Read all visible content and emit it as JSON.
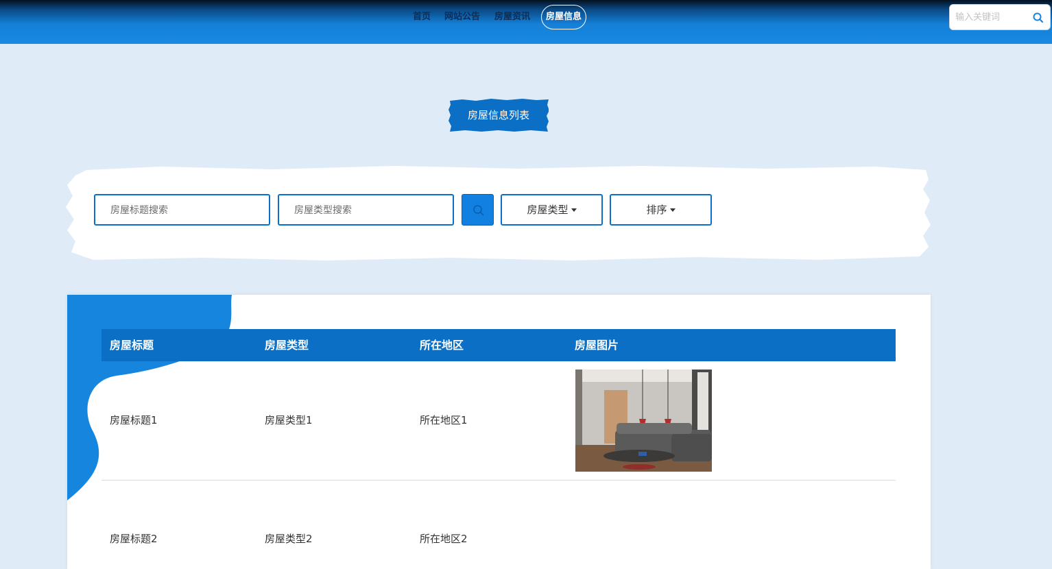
{
  "nav": {
    "items": [
      "首页",
      "网站公告",
      "房屋资讯",
      "房屋信息"
    ],
    "active_index": 3
  },
  "search": {
    "placeholder": "输入关键词"
  },
  "page_title": "房屋信息列表",
  "filters": {
    "title_placeholder": "房屋标题搜索",
    "type_placeholder": "房屋类型搜索",
    "type_dropdown": "房屋类型",
    "sort_dropdown": "排序"
  },
  "table": {
    "headers": [
      "房屋标题",
      "房屋类型",
      "所在地区",
      "房屋图片"
    ],
    "rows": [
      {
        "title": "房屋标题1",
        "type": "房屋类型1",
        "region": "所在地区1"
      },
      {
        "title": "房屋标题2",
        "type": "房屋类型2",
        "region": "所在地区2"
      }
    ]
  },
  "colors": {
    "accent": "#0b6fc6",
    "background": "#dfecf8",
    "nav_bright": "#1989e2"
  },
  "icons": {
    "search": "search-icon",
    "caret": "caret-down-icon"
  }
}
